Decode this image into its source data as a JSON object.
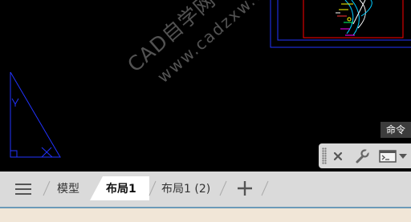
{
  "watermark": {
    "site_name": "CAD自学网",
    "url": "www.cadzxw.com"
  },
  "command_tooltip": "命令",
  "command_toolbar": {
    "icons": [
      "grip-icon",
      "close-icon",
      "wrench-icon",
      "command-line-icon",
      "chevron-down-icon"
    ]
  },
  "layout_tabs": {
    "menu_icon": "hamburger-menu-icon",
    "tabs": [
      {
        "label": "模型",
        "active": false
      },
      {
        "label": "布局1",
        "active": true
      },
      {
        "label": "布局1 (2)",
        "active": false
      }
    ],
    "add_icon": "plus-icon"
  },
  "colors": {
    "model_space_bg": "#000000",
    "drawing_blue": "#2233ff",
    "drawing_red": "#ff0000",
    "tab_bar_bg": "#dadada",
    "active_tab_bg": "#ffffff",
    "status_strip": "#f1e6d7"
  }
}
